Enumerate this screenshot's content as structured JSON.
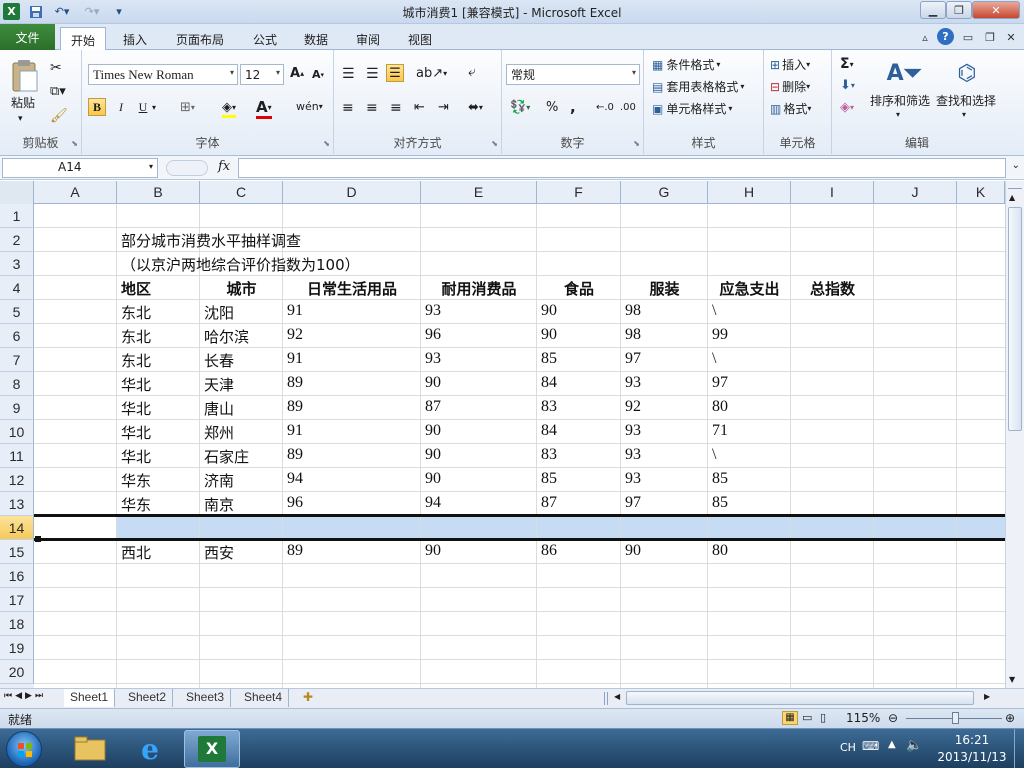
{
  "window": {
    "title": "城市消费1  [兼容模式] - Microsoft Excel",
    "app_icon": "excel-icon"
  },
  "tabs": [
    "文件",
    "开始",
    "插入",
    "页面布局",
    "公式",
    "数据",
    "审阅",
    "视图"
  ],
  "active_tab": "开始",
  "ribbon": {
    "clipboard": {
      "paste": "粘贴",
      "label": "剪贴板"
    },
    "font": {
      "name": "Times New Roman",
      "size": "12",
      "label": "字体"
    },
    "alignment": {
      "label": "对齐方式"
    },
    "number": {
      "format": "常规",
      "percent": "%",
      "comma": ",",
      "label": "数字"
    },
    "styles": {
      "conditional": "条件格式",
      "table": "套用表格格式",
      "cell_styles": "单元格样式",
      "label": "样式"
    },
    "cells": {
      "insert": "插入",
      "delete": "删除",
      "format": "格式",
      "label": "单元格"
    },
    "editing": {
      "sort_filter": "排序和筛选",
      "find_select": "查找和选择",
      "label": "编辑"
    }
  },
  "formula_bar": {
    "name_box": "A14",
    "fx": "fx",
    "formula": ""
  },
  "columns": [
    "A",
    "B",
    "C",
    "D",
    "E",
    "F",
    "G",
    "H",
    "I",
    "J",
    "K"
  ],
  "selected_column": "A",
  "rows": [
    "1",
    "2",
    "3",
    "4",
    "5",
    "6",
    "7",
    "8",
    "9",
    "10",
    "11",
    "12",
    "13",
    "14",
    "15",
    "16",
    "17",
    "18",
    "19",
    "20"
  ],
  "selected_row": "14",
  "sheet": {
    "title": "部分城市消费水平抽样调查",
    "subtitle": "（以京沪两地综合评价指数为100）",
    "headers": [
      "地区",
      "城市",
      "日常生活用品",
      "耐用消费品",
      "食品",
      "服装",
      "应急支出",
      "总指数"
    ],
    "data": [
      [
        "东北",
        "沈阳",
        "91",
        "93",
        "90",
        "98",
        "\\"
      ],
      [
        "东北",
        "哈尔滨",
        "92",
        "96",
        "90",
        "98",
        "99"
      ],
      [
        "东北",
        "长春",
        "91",
        "93",
        "85",
        "97",
        "\\"
      ],
      [
        "华北",
        "天津",
        "89",
        "90",
        "84",
        "93",
        "97"
      ],
      [
        "华北",
        "唐山",
        "89",
        "87",
        "83",
        "92",
        "80"
      ],
      [
        "华北",
        "郑州",
        "91",
        "90",
        "84",
        "93",
        "71"
      ],
      [
        "华北",
        "石家庄",
        "89",
        "90",
        "83",
        "93",
        "\\"
      ],
      [
        "华东",
        "济南",
        "94",
        "90",
        "85",
        "93",
        "85"
      ],
      [
        "华东",
        "南京",
        "96",
        "94",
        "87",
        "97",
        "85"
      ],
      [
        "",
        "",
        "",
        "",
        "",
        "",
        ""
      ],
      [
        "西北",
        "西安",
        "89",
        "90",
        "86",
        "90",
        "80"
      ]
    ]
  },
  "sheet_tabs": [
    "Sheet1",
    "Sheet2",
    "Sheet3",
    "Sheet4"
  ],
  "active_sheet": "Sheet1",
  "status": {
    "ready": "就绪",
    "zoom": "115%"
  },
  "taskbar": {
    "lang": "CH",
    "time": "16:21",
    "date": "2013/11/13"
  }
}
